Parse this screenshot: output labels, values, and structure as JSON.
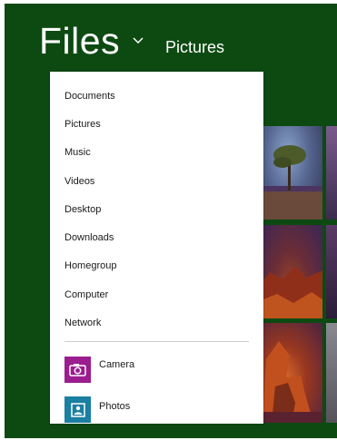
{
  "header": {
    "title": "Files",
    "breadcrumb": "Pictures"
  },
  "menu": {
    "locations": [
      "Documents",
      "Pictures",
      "Music",
      "Videos",
      "Desktop",
      "Downloads",
      "Homegroup",
      "Computer",
      "Network"
    ],
    "apps": [
      {
        "label": "Camera",
        "icon": "camera-icon",
        "color": "#9b1d8e"
      },
      {
        "label": "Photos",
        "icon": "photos-icon",
        "color": "#1a7fa0"
      }
    ]
  },
  "colors": {
    "background": "#0d4a12",
    "menu": "#ffffff"
  }
}
